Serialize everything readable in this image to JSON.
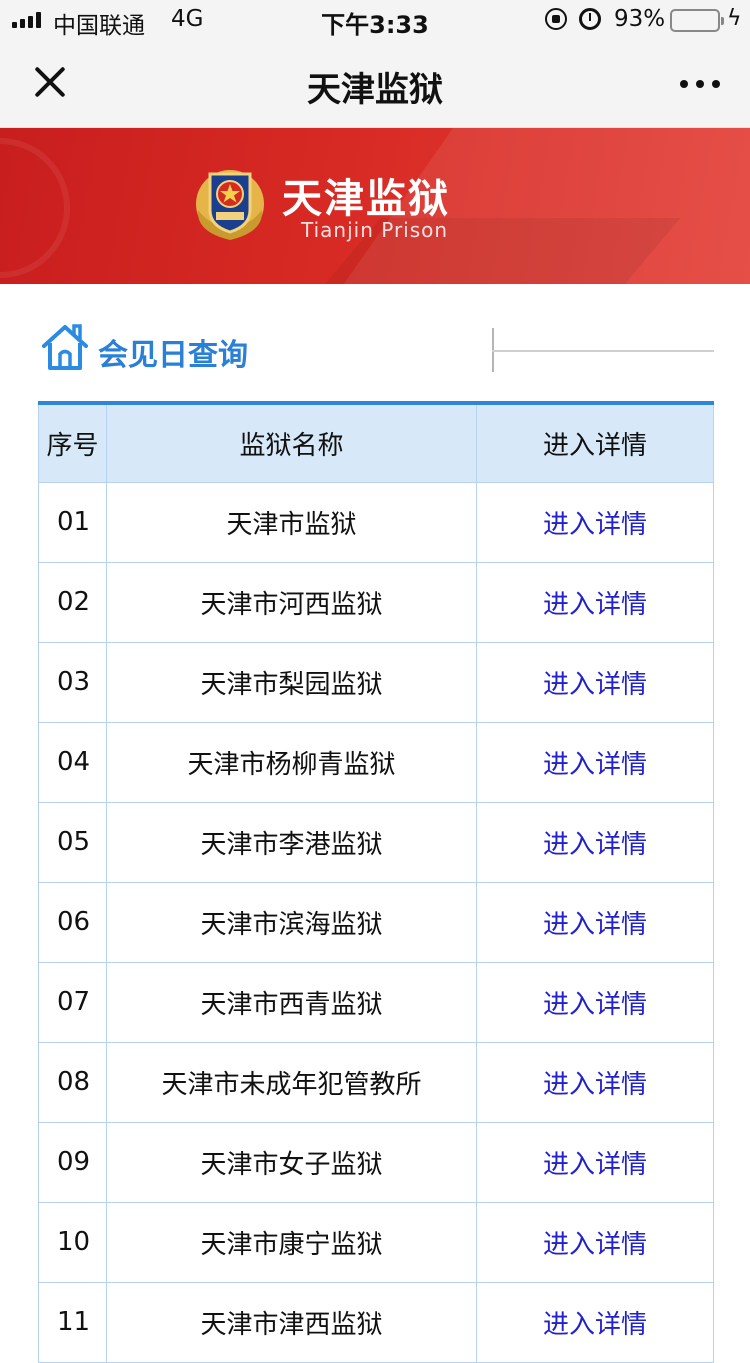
{
  "status_bar": {
    "carrier": "中国联通",
    "network": "4G",
    "time": "下午3:33",
    "battery": "93%",
    "battery_level": 0.93
  },
  "nav": {
    "title": "天津监狱"
  },
  "banner": {
    "title": "天津监狱",
    "subtitle": "Tianjin Prison",
    "colors": {
      "primary": "#d82a24"
    }
  },
  "section": {
    "title": "会见日查询",
    "accent": "#2a7fd6"
  },
  "table": {
    "headers": {
      "no": "序号",
      "name": "监狱名称",
      "link": "进入详情"
    },
    "rows": [
      {
        "no": "01",
        "name": "天津市监狱",
        "link": "进入详情"
      },
      {
        "no": "02",
        "name": "天津市河西监狱",
        "link": "进入详情"
      },
      {
        "no": "03",
        "name": "天津市梨园监狱",
        "link": "进入详情"
      },
      {
        "no": "04",
        "name": "天津市杨柳青监狱",
        "link": "进入详情"
      },
      {
        "no": "05",
        "name": "天津市李港监狱",
        "link": "进入详情"
      },
      {
        "no": "06",
        "name": "天津市滨海监狱",
        "link": "进入详情"
      },
      {
        "no": "07",
        "name": "天津市西青监狱",
        "link": "进入详情"
      },
      {
        "no": "08",
        "name": "天津市未成年犯管教所",
        "link": "进入详情"
      },
      {
        "no": "09",
        "name": "天津市女子监狱",
        "link": "进入详情"
      },
      {
        "no": "10",
        "name": "天津市康宁监狱",
        "link": "进入详情"
      },
      {
        "no": "11",
        "name": "天津市津西监狱",
        "link": "进入详情"
      }
    ]
  }
}
